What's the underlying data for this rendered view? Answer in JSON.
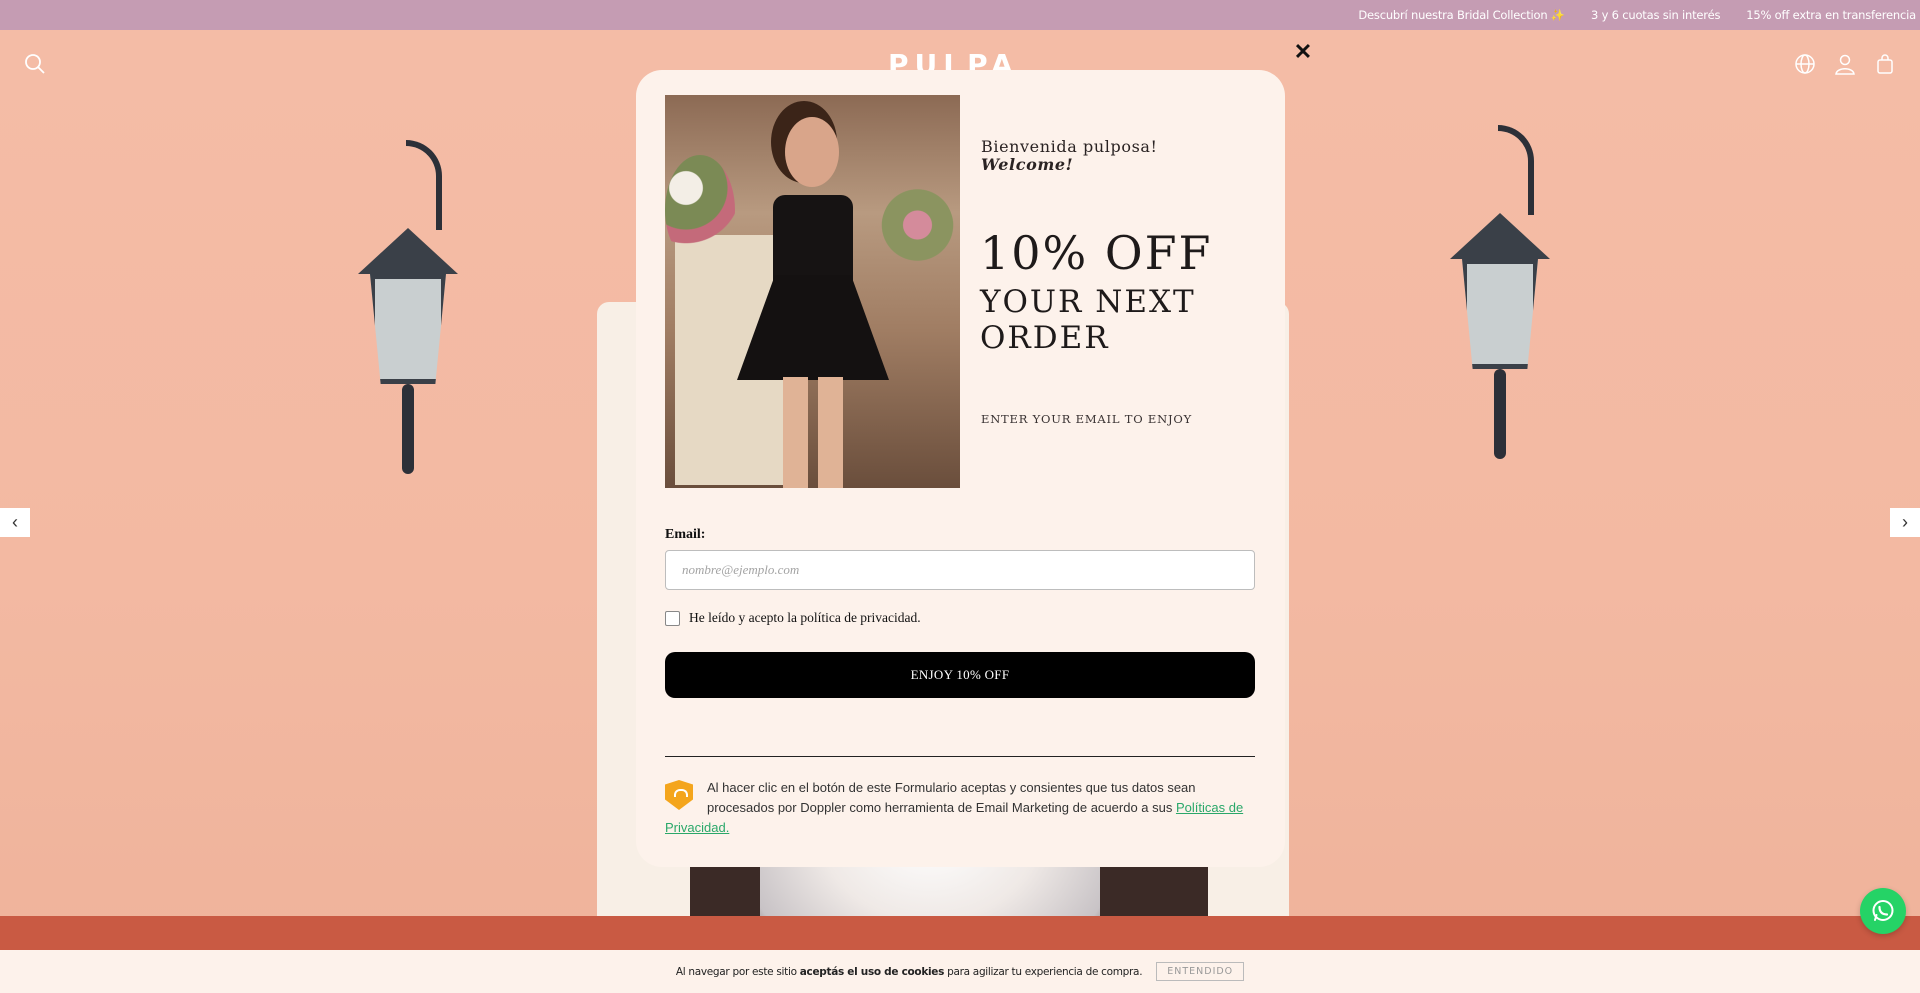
{
  "topbar": {
    "messages": [
      "Descubrí nuestra Bridal Collection ✨",
      "3 y 6 cuotas sin interés",
      "15% off extra en transferencia"
    ]
  },
  "header": {
    "logo": "PULPA",
    "icons": [
      "search-icon",
      "globe-icon",
      "user-icon",
      "bag-icon"
    ]
  },
  "slider": {
    "prev": "‹",
    "next": "›"
  },
  "popup": {
    "close": "✕",
    "greeting": "Bienvenida pulposa!",
    "greeting_en": "Welcome!",
    "headline": "10% OFF",
    "subheadline": "YOUR NEXT ORDER",
    "cta_text": "ENTER YOUR EMAIL TO ENJOY",
    "email_label": "Email:",
    "email_placeholder": "nombre@ejemplo.com",
    "email_value": "",
    "privacy_label": "He leído y acepto la política de privacidad.",
    "submit_label": "ENJOY 10% OFF",
    "consent_text": "Al hacer clic en el botón de este Formulario aceptas y consientes que tus datos sean procesados por Doppler como herramienta de Email Marketing de acuerdo a sus ",
    "consent_link": "Políticas de Privacidad."
  },
  "cookie": {
    "text_before": "Al navegar por este sitio ",
    "text_bold": "aceptás el uso de cookies",
    "text_after": " para agilizar tu experiencia de compra.",
    "button": "ENTENDIDO"
  },
  "colors": {
    "topbar": "#c59cb3",
    "background": "#f2b9a3",
    "popup": "#fdf2eb",
    "accent_green": "#2aa86a",
    "whatsapp": "#25d366"
  }
}
